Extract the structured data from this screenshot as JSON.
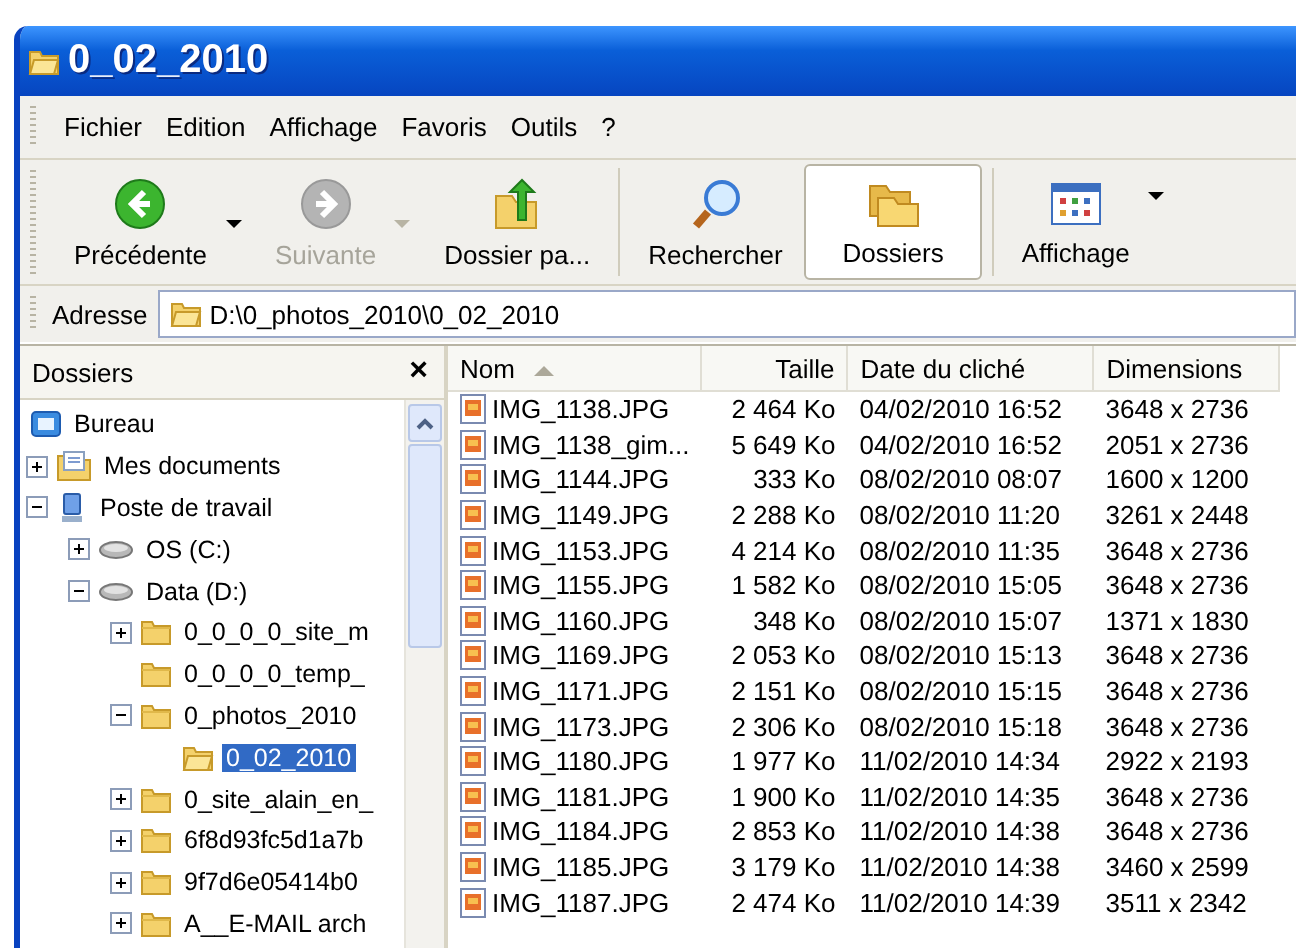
{
  "window": {
    "title": "0_02_2010"
  },
  "menu": [
    "Fichier",
    "Edition",
    "Affichage",
    "Favoris",
    "Outils",
    "?"
  ],
  "toolbar": [
    {
      "label": "Précédente",
      "kind": "back",
      "disabled": false,
      "pressed": false,
      "dropdown": true
    },
    {
      "label": "Suivante",
      "kind": "forward",
      "disabled": true,
      "pressed": false,
      "dropdown": true
    },
    {
      "label": "Dossier pa...",
      "kind": "up",
      "disabled": false,
      "pressed": false,
      "dropdown": false
    },
    {
      "kind": "separator"
    },
    {
      "label": "Rechercher",
      "kind": "search",
      "disabled": false,
      "pressed": false,
      "dropdown": false
    },
    {
      "label": "Dossiers",
      "kind": "folders",
      "disabled": false,
      "pressed": true,
      "dropdown": false
    },
    {
      "kind": "separator"
    },
    {
      "label": "Affichage",
      "kind": "views",
      "disabled": false,
      "pressed": false,
      "dropdown": true
    }
  ],
  "address": {
    "label": "Adresse",
    "value": "D:\\0_photos_2010\\0_02_2010"
  },
  "folders_pane": {
    "title": "Dossiers",
    "close": "×",
    "tree": [
      {
        "label": "Bureau",
        "kind": "desktop",
        "selected": false,
        "children": [
          {
            "label": "Mes documents",
            "kind": "documents",
            "expanded": false,
            "selected": false
          },
          {
            "label": "Poste de travail",
            "kind": "computer",
            "expanded": true,
            "selected": false,
            "children": [
              {
                "label": "OS (C:)",
                "kind": "drive",
                "expanded": false,
                "selected": false
              },
              {
                "label": "Data (D:)",
                "kind": "drive",
                "expanded": true,
                "selected": false,
                "children": [
                  {
                    "label": "0_0_0_0_site_m",
                    "kind": "folder",
                    "expanded": false,
                    "selected": false
                  },
                  {
                    "label": "0_0_0_0_temp_",
                    "kind": "folder",
                    "selected": false
                  },
                  {
                    "label": "0_photos_2010",
                    "kind": "folder",
                    "expanded": true,
                    "selected": false,
                    "children": [
                      {
                        "label": "0_02_2010",
                        "kind": "open-folder",
                        "selected": true
                      }
                    ]
                  },
                  {
                    "label": "0_site_alain_en_",
                    "kind": "folder",
                    "expanded": false,
                    "selected": false
                  },
                  {
                    "label": "6f8d93fc5d1a7b",
                    "kind": "folder",
                    "expanded": false,
                    "selected": false
                  },
                  {
                    "label": "9f7d6e05414b0",
                    "kind": "folder",
                    "expanded": false,
                    "selected": false
                  },
                  {
                    "label": "A__E-MAIL arch",
                    "kind": "folder",
                    "expanded": false,
                    "selected": false
                  }
                ]
              }
            ]
          }
        ]
      }
    ]
  },
  "file_list": {
    "columns": [
      {
        "label": "Nom",
        "sorted": true
      },
      {
        "label": "Taille",
        "sorted": false
      },
      {
        "label": "Date du cliché",
        "sorted": false
      },
      {
        "label": "Dimensions",
        "sorted": false
      }
    ],
    "rows": [
      [
        "IMG_1138.JPG",
        "2 464 Ko",
        "04/02/2010 16:52",
        "3648 x 2736"
      ],
      [
        "IMG_1138_gim...",
        "5 649 Ko",
        "04/02/2010 16:52",
        "2051 x 2736"
      ],
      [
        "IMG_1144.JPG",
        "333 Ko",
        "08/02/2010 08:07",
        "1600 x 1200"
      ],
      [
        "IMG_1149.JPG",
        "2 288 Ko",
        "08/02/2010 11:20",
        "3261 x 2448"
      ],
      [
        "IMG_1153.JPG",
        "4 214 Ko",
        "08/02/2010 11:35",
        "3648 x 2736"
      ],
      [
        "IMG_1155.JPG",
        "1 582 Ko",
        "08/02/2010 15:05",
        "3648 x 2736"
      ],
      [
        "IMG_1160.JPG",
        "348 Ko",
        "08/02/2010 15:07",
        "1371 x 1830"
      ],
      [
        "IMG_1169.JPG",
        "2 053 Ko",
        "08/02/2010 15:13",
        "3648 x 2736"
      ],
      [
        "IMG_1171.JPG",
        "2 151 Ko",
        "08/02/2010 15:15",
        "3648 x 2736"
      ],
      [
        "IMG_1173.JPG",
        "2 306 Ko",
        "08/02/2010 15:18",
        "3648 x 2736"
      ],
      [
        "IMG_1180.JPG",
        "1 977 Ko",
        "11/02/2010 14:34",
        "2922 x 2193"
      ],
      [
        "IMG_1181.JPG",
        "1 900 Ko",
        "11/02/2010 14:35",
        "3648 x 2736"
      ],
      [
        "IMG_1184.JPG",
        "2 853 Ko",
        "11/02/2010 14:38",
        "3648 x 2736"
      ],
      [
        "IMG_1185.JPG",
        "3 179 Ko",
        "11/02/2010 14:38",
        "3460 x 2599"
      ],
      [
        "IMG_1187.JPG",
        "2 474 Ko",
        "11/02/2010 14:39",
        "3511 x 2342"
      ]
    ]
  }
}
